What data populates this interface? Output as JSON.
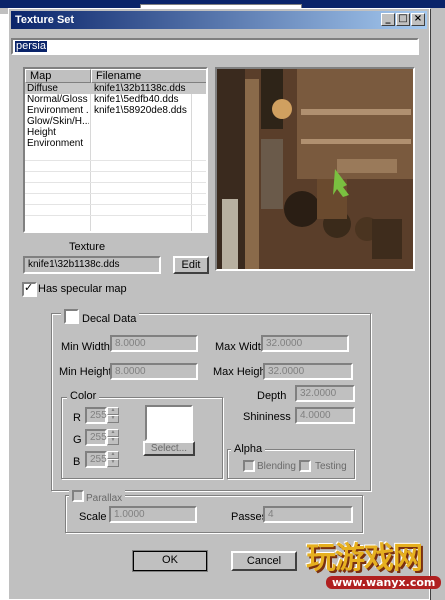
{
  "dialog": {
    "title": "Texture Set",
    "minimize": "_",
    "maximize": "□",
    "close": "×"
  },
  "name_field": {
    "value": "persia"
  },
  "map_table": {
    "columns": [
      "Map",
      "Filename"
    ],
    "rows": [
      {
        "map": "Diffuse",
        "file": "knife1\\32b1138c.dds"
      },
      {
        "map": "Normal/Gloss",
        "file": "knife1\\5edfb40.dds"
      },
      {
        "map": "Environment ...",
        "file": "knife1\\58920de8.dds"
      },
      {
        "map": "Glow/Skin/H...",
        "file": ""
      },
      {
        "map": "Height",
        "file": ""
      },
      {
        "map": "Environment",
        "file": ""
      }
    ]
  },
  "texture": {
    "label": "Texture",
    "value": "knife1\\32b1138c.dds",
    "edit_button": "Edit"
  },
  "has_specular": {
    "label": "Has specular map",
    "checked": true
  },
  "decal": {
    "label": "Decal Data",
    "min_width_label": "Min Width",
    "min_width": "8.0000",
    "max_width_label": "Max Width",
    "max_width": "32.0000",
    "min_height_label": "Min Height",
    "min_height": "8.0000",
    "max_height_label": "Max Height",
    "max_height": "32.0000",
    "depth_label": "Depth",
    "depth": "32.0000",
    "shininess_label": "Shininess",
    "shininess": "4.0000",
    "color": {
      "label": "Color",
      "r_label": "R",
      "r": "255",
      "g_label": "G",
      "g": "255",
      "b_label": "B",
      "b": "255",
      "select_button": "Select..."
    },
    "alpha": {
      "label": "Alpha",
      "blending_label": "Blending",
      "testing_label": "Testing"
    }
  },
  "parallax": {
    "label": "Parallax",
    "scale_label": "Scale",
    "scale": "1.0000",
    "passes_label": "Passes",
    "passes": "4"
  },
  "buttons": {
    "ok": "OK",
    "cancel": "Cancel"
  },
  "watermark": {
    "main": "玩游戏网",
    "url": "www.wanyx.com"
  },
  "colors": {
    "title_active": "#0a246a",
    "dialog_face": "#c0c0c0",
    "selection": "#0a246a"
  }
}
